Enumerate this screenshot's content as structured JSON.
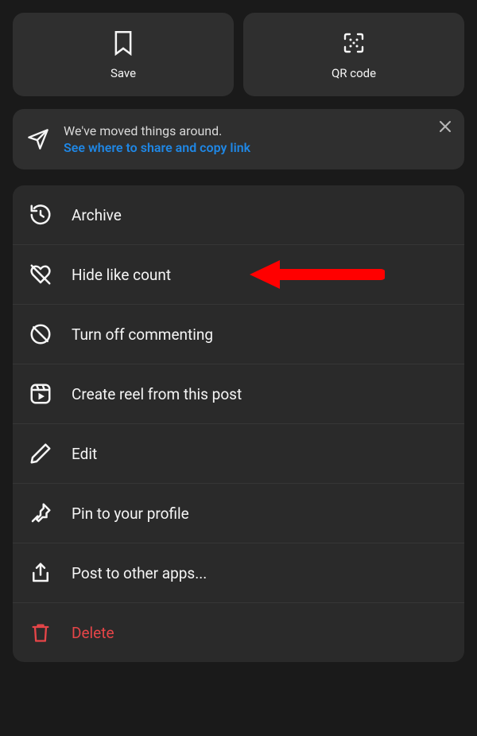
{
  "topButtons": {
    "save": {
      "label": "Save"
    },
    "qrcode": {
      "label": "QR code"
    }
  },
  "banner": {
    "line1": "We've moved things around.",
    "line2": "See where to share and copy link"
  },
  "menu": {
    "archive": {
      "label": "Archive"
    },
    "hideLikeCount": {
      "label": "Hide like count"
    },
    "turnOffCommenting": {
      "label": "Turn off commenting"
    },
    "createReel": {
      "label": "Create reel from this post"
    },
    "edit": {
      "label": "Edit"
    },
    "pinToProfile": {
      "label": "Pin to your profile"
    },
    "postToOtherApps": {
      "label": "Post to other apps..."
    },
    "delete": {
      "label": "Delete"
    }
  }
}
